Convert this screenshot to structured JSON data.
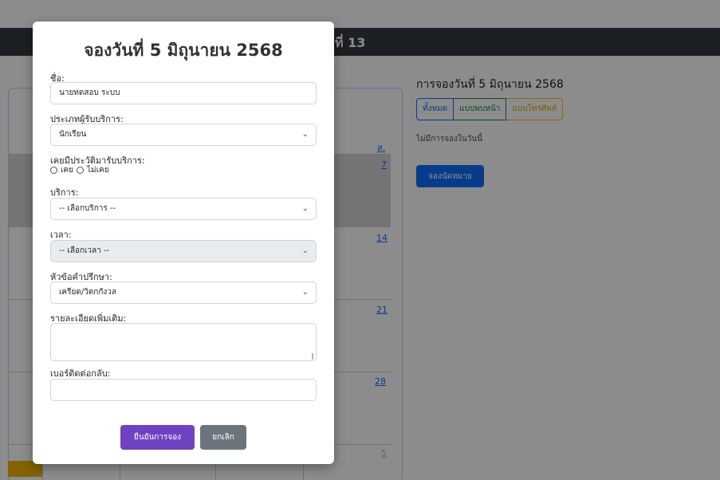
{
  "background": {
    "banner_title": "ที่ 13",
    "calendar": {
      "sat_header": "ส.",
      "days": [
        "7",
        "14",
        "21",
        "28",
        "5"
      ]
    },
    "side": {
      "title": "การจองวันที่ 5 มิถุนายน 2568",
      "filters": [
        "ทั้งหมด",
        "แบบพบหน้า",
        "แบบโทรศัพท์"
      ],
      "empty_text": "ไม่มีการจองในวันนี้",
      "book_button": "จองนัดหมาย"
    }
  },
  "modal": {
    "title": "จองวันที่ 5 มิถุนายน 2568",
    "name": {
      "label": "ชื่อ:",
      "value": "นายทดสอบ ระบบ"
    },
    "client_type": {
      "label": "ประเภทผู้รับบริการ:",
      "value": "นักเรียน"
    },
    "history": {
      "label": "เคยมีประวัติมารับบริการ:",
      "options": [
        "เคย",
        "ไม่เคย"
      ]
    },
    "service": {
      "label": "บริการ:",
      "value": "-- เลือกบริการ --"
    },
    "time": {
      "label": "เวลา:",
      "value": "-- เลือกเวลา --"
    },
    "topic": {
      "label": "หัวข้อคำปรึกษา:",
      "value": "เครียด/วิตกกังวล"
    },
    "details": {
      "label": "รายละเอียดเพิ่มเติม:",
      "value": ""
    },
    "phone": {
      "label": "เบอร์ติดต่อกลับ:",
      "value": ""
    },
    "confirm_label": "ยืนยันการจอง",
    "cancel_label": "ยกเลิก"
  },
  "colors": {
    "confirm": "#6f42c1",
    "cancel": "#6c757d",
    "primary": "#0d6efd",
    "banner": "#343a40"
  }
}
